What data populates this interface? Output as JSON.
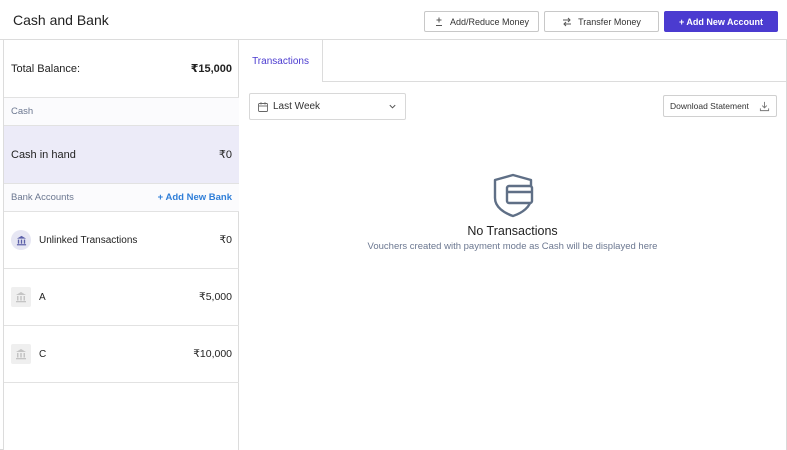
{
  "header": {
    "title": "Cash and Bank",
    "add_reduce_label": "Add/Reduce Money",
    "transfer_label": "Transfer Money",
    "add_account_label": "+ Add New Account"
  },
  "left": {
    "total_label": "Total Balance:",
    "total_amount": "₹15,000",
    "cash_section": "Cash",
    "cash_in_hand_label": "Cash in hand",
    "cash_in_hand_amount": "₹0",
    "bank_section": "Bank Accounts",
    "add_bank_label": "+ Add New Bank",
    "banks": [
      {
        "name": "Unlinked Transactions",
        "amount": "₹0",
        "icon": "bank-icon"
      },
      {
        "name": "A",
        "amount": "₹5,000",
        "icon": "bank-icon"
      },
      {
        "name": "C",
        "amount": "₹10,000",
        "icon": "bank-icon"
      }
    ]
  },
  "right": {
    "tab_label": "Transactions",
    "date_filter": "Last Week",
    "download_label": "Download Statement",
    "empty_title": "No Transactions",
    "empty_subtitle": "Vouchers created with payment mode as Cash will be displayed here"
  },
  "colors": {
    "accent": "#4b3bd0",
    "link": "#2f7ed8",
    "selected_bg": "#ecebf8",
    "muted_text": "#6b7790"
  }
}
